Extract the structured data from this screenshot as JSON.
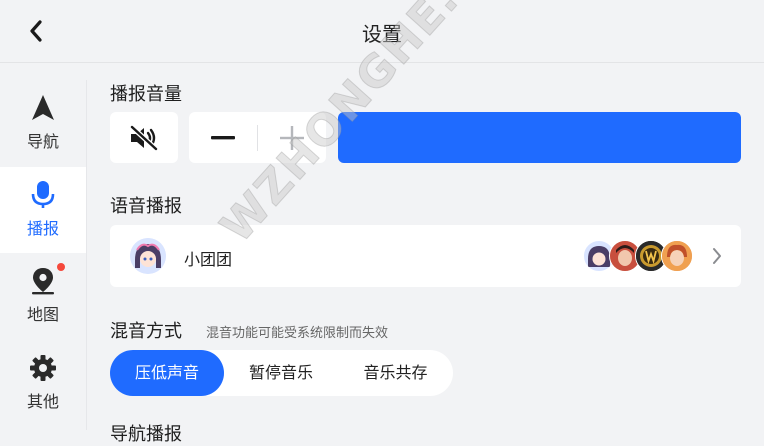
{
  "header": {
    "title": "设置",
    "back_icon": "chevron-left-icon"
  },
  "sidebar": {
    "items": [
      {
        "label": "导航",
        "icon": "navigation-arrow-icon",
        "active": false
      },
      {
        "label": "播报",
        "icon": "microphone-icon",
        "active": true
      },
      {
        "label": "地图",
        "icon": "map-pin-icon",
        "active": false,
        "badge": "red-dot"
      },
      {
        "label": "其他",
        "icon": "gear-icon",
        "active": false
      }
    ]
  },
  "volume": {
    "title": "播报音量",
    "mute_icon": "speaker-muted-icon",
    "minus_icon": "minus-icon",
    "plus_icon": "plus-icon",
    "level": 1.0,
    "accent": "#1f6bff"
  },
  "voice": {
    "title": "语音播报",
    "selected_name": "小团团",
    "avatar_icon": "voice-avatar",
    "more_icon": "chevron-right-icon"
  },
  "mix": {
    "title": "混音方式",
    "hint": "混音功能可能受系统限制而失效",
    "options": [
      "压低声音",
      "暂停音乐",
      "音乐共存"
    ],
    "selected": "压低声音"
  },
  "next_section": {
    "title": "导航播报"
  },
  "watermark": "WZHONGHE.COM"
}
